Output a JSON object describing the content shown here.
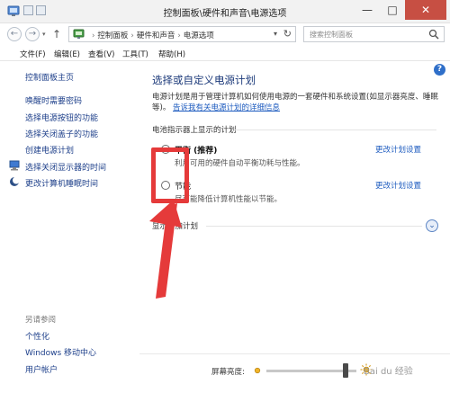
{
  "window": {
    "title": "控制面板\\硬件和声音\\电源选项",
    "minimize_glyph": "—",
    "maximize_glyph": "□",
    "close_glyph": "✕"
  },
  "address_bar": {
    "back_glyph": "←",
    "forward_glyph": "→",
    "dropdown_glyph": "▾",
    "up_glyph": "↑",
    "crumbs": [
      "控制面板",
      "硬件和声音",
      "电源选项"
    ],
    "crumb_sep": "›",
    "search_placeholder": "搜索控制面板",
    "refresh_glyph": "↻"
  },
  "menu": {
    "items": [
      "文件(F)",
      "编辑(E)",
      "查看(V)",
      "工具(T)",
      "帮助(H)"
    ]
  },
  "sidebar": {
    "home": "控制面板主页",
    "links": [
      "唤醒时需要密码",
      "选择电源按钮的功能",
      "选择关闭盖子的功能",
      "创建电源计划",
      "选择关闭显示器的时间",
      "更改计算机睡眠时间"
    ],
    "see_also_title": "另请参阅",
    "see_also_links": [
      "个性化",
      "Windows 移动中心",
      "用户帐户"
    ]
  },
  "main": {
    "help_glyph": "?",
    "title": "选择或自定义电源计划",
    "description": "电源计划是用于管理计算机如何使用电源的一套硬件和系统设置(如显示器亮度、睡眠等)。",
    "description_link": "告诉我有关电源计划的详细信息",
    "section_label": "电池指示器上显示的计划",
    "plans": [
      {
        "name": "平衡 (推荐)",
        "description": "利用可用的硬件自动平衡功耗与性能。",
        "selected": true,
        "link": "更改计划设置"
      },
      {
        "name": "节能",
        "description": "尽可能降低计算机性能以节能。",
        "selected": false,
        "link": "更改计划设置"
      }
    ],
    "more_label": "显示附加计划",
    "expand_glyph": "⌄",
    "brightness_label": "屏幕亮度:",
    "brightness_level": 0.88
  },
  "annotation": {
    "color": "#e53a3a",
    "watermark": "Bai du 经验"
  }
}
